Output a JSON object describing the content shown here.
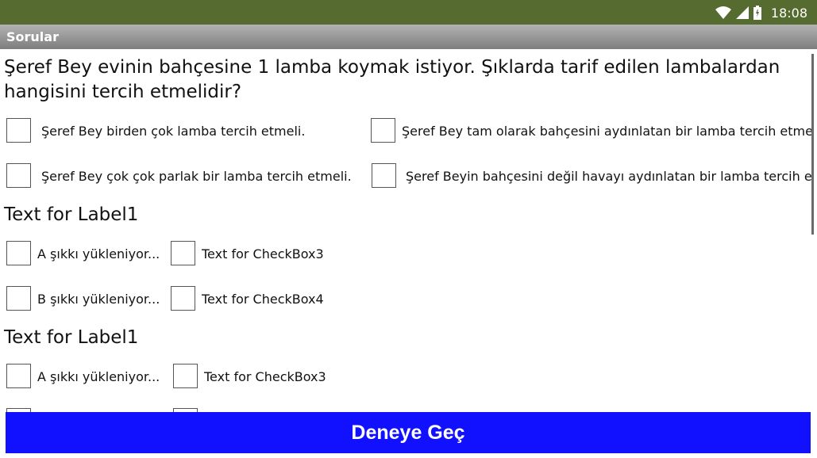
{
  "status_bar": {
    "time": "18:08",
    "bg_color": "#556b2f"
  },
  "title_bar": {
    "title": "Sorular"
  },
  "question": {
    "line1": " Şeref Bey evinin bahçesine 1 lamba koymak istiyor. Şıklarda tarif edilen lambalardan",
    "line2": "hangisini tercih etmelidir?"
  },
  "options": [
    {
      "label": "Şeref Bey birden çok lamba tercih etmeli."
    },
    {
      "label": "Şeref Bey tam olarak bahçesini aydınlatan bir lamba tercih etmeli."
    },
    {
      "label": "Şeref Bey çok çok parlak bir lamba tercih etmeli."
    },
    {
      "label": "Şeref Beyin bahçesini değil havayı aydınlatan bir lamba tercih etmeli."
    }
  ],
  "section1": {
    "label": "Text for Label1",
    "rows": [
      {
        "a": "A şıkkı yükleniyor...",
        "b": "Text for CheckBox3"
      },
      {
        "a": "B şıkkı yükleniyor...",
        "b": "Text for CheckBox4"
      }
    ]
  },
  "section2": {
    "label": "Text for Label1",
    "rows": [
      {
        "a": "A şıkkı yükleniyor...",
        "b": "Text for CheckBox3"
      }
    ]
  },
  "button": {
    "label": "Deneye Geç",
    "color": "#1111ff"
  }
}
